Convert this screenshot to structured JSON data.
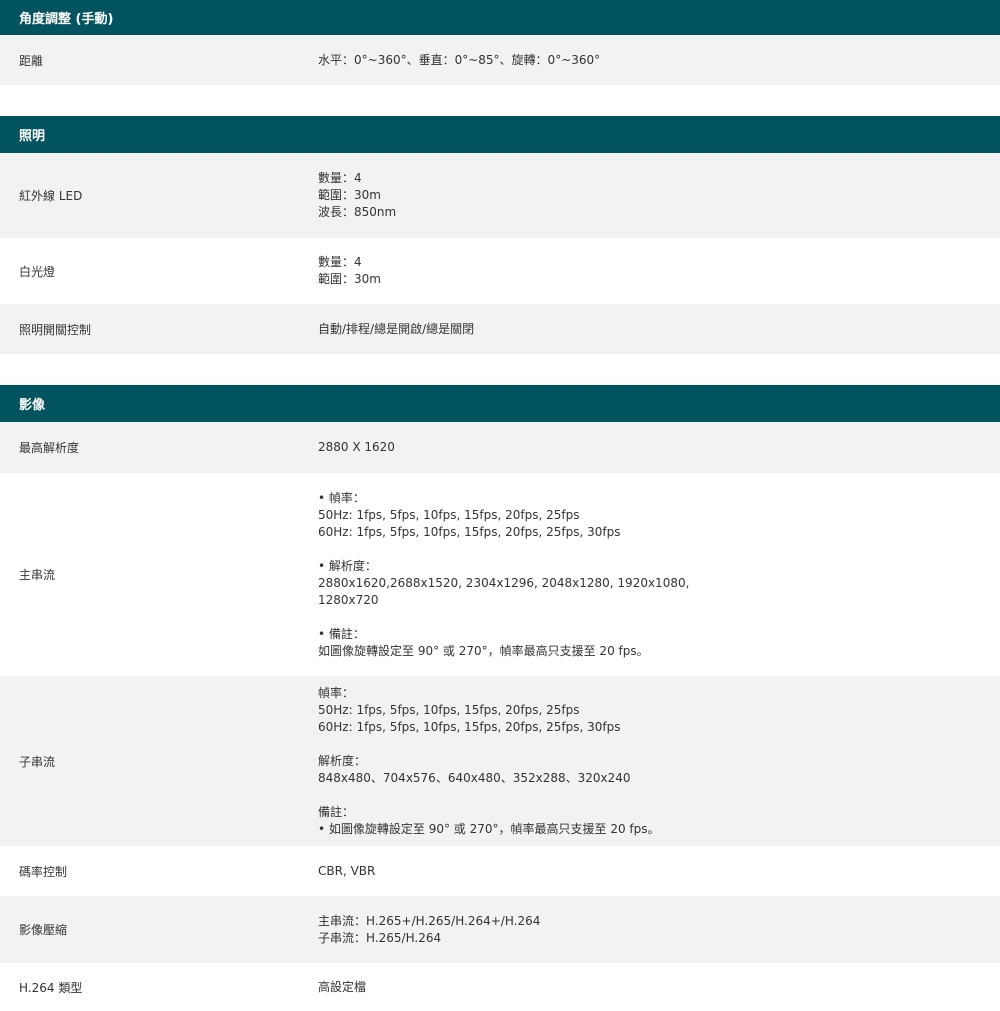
{
  "sections": [
    {
      "title": "角度調整 (手動)",
      "rows": [
        {
          "label": "距離",
          "lines": [
            "水平：0°~360°、垂直：0°~85°、旋轉：0°~360°"
          ]
        }
      ]
    },
    {
      "title": "照明",
      "rows": [
        {
          "label": "紅外線 LED",
          "lines": [
            "數量：4",
            "範圍：30m",
            "波長：850nm"
          ]
        },
        {
          "label": "白光燈",
          "lines": [
            "數量：4",
            "範圍：30m"
          ]
        },
        {
          "label": "照明開關控制",
          "lines": [
            "自動/排程/總是開啟/總是關閉"
          ]
        }
      ]
    },
    {
      "title": "影像",
      "rows": [
        {
          "label": "最高解析度",
          "lines": [
            "2880 X 1620"
          ]
        },
        {
          "label": "主串流",
          "lines": [
            "• 幀率：",
            "50Hz: 1fps, 5fps, 10fps, 15fps, 20fps, 25fps",
            "60Hz: 1fps, 5fps, 10fps, 15fps, 20fps, 25fps, 30fps",
            "",
            "• 解析度：",
            "2880x1620,2688x1520, 2304x1296, 2048x1280, 1920x1080,",
            "1280x720",
            "",
            "• 備註：",
            "如圖像旋轉設定至 90° 或 270°，幀率最高只支援至 20 fps。"
          ]
        },
        {
          "label": "子串流",
          "lines": [
            "幀率：",
            "50Hz: 1fps, 5fps, 10fps, 15fps, 20fps, 25fps",
            "60Hz: 1fps, 5fps, 10fps, 15fps, 20fps, 25fps, 30fps",
            "",
            "解析度：",
            "848x480、704x576、640x480、352x288、320x240",
            "",
            "備註：",
            "• 如圖像旋轉設定至 90° 或 270°，幀率最高只支援至 20 fps。"
          ]
        },
        {
          "label": "碼率控制",
          "lines": [
            "CBR, VBR"
          ]
        },
        {
          "label": "影像壓縮",
          "lines": [
            "主串流：H.265+/H.265/H.264+/H.264",
            "子串流：H.265/H.264"
          ]
        },
        {
          "label": "H.264 類型",
          "lines": [
            "高設定檔"
          ]
        }
      ]
    }
  ]
}
